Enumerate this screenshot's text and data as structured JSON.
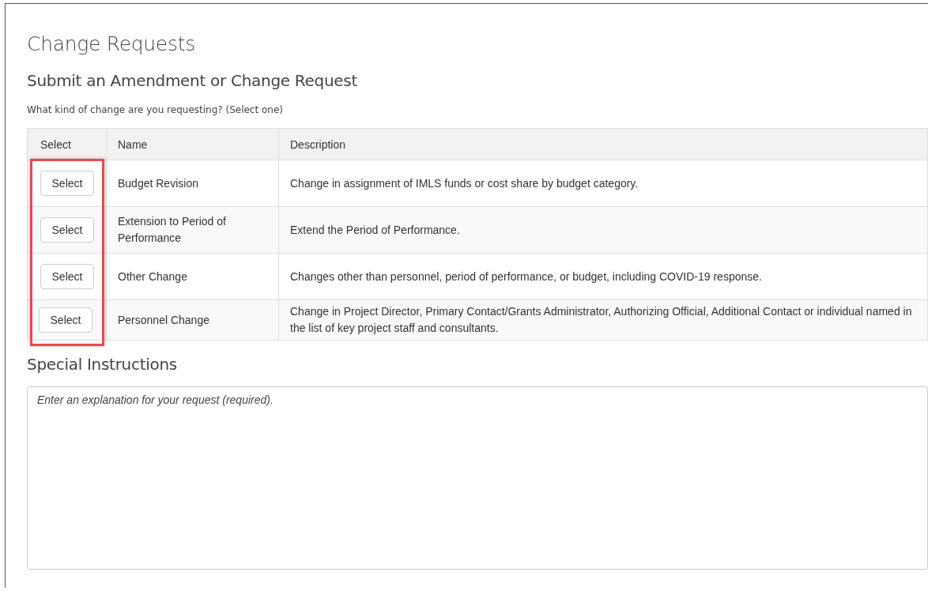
{
  "title": "Change Requests",
  "subtitle": "Submit an Amendment or Change Request",
  "prompt": "What kind of change are you requesting? (Select one)",
  "table": {
    "columns": [
      "Select",
      "Name",
      "Description"
    ],
    "rows": [
      {
        "button": "Select",
        "name": "Budget Revision",
        "description": "Change in assignment of IMLS funds or cost share by budget category."
      },
      {
        "button": "Select",
        "name": "Extension to Period of Performance",
        "description": "Extend the Period of Performance."
      },
      {
        "button": "Select",
        "name": "Other Change",
        "description": "Changes other than personnel, period of performance, or budget, including COVID-19 response."
      },
      {
        "button": "Select",
        "name": "Personnel Change",
        "description": "Change in Project Director, Primary Contact/Grants Administrator, Authorizing Official, Additional Contact or individual named in the list of key project staff and consultants."
      }
    ]
  },
  "special_instructions": {
    "heading": "Special Instructions",
    "placeholder": "Enter an explanation for your request (required)."
  }
}
